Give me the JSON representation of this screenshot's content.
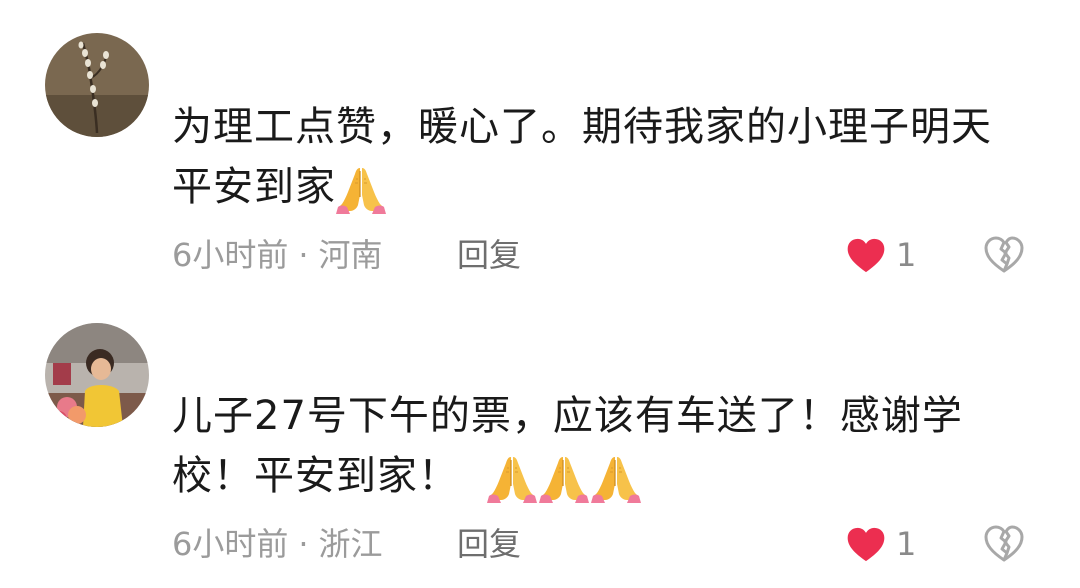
{
  "comments": [
    {
      "text": "为理工点赞，暖心了。期待我家的小理子明天平安到家",
      "time": "6小时前",
      "separator": "·",
      "location": "河南",
      "reply_label": "回复",
      "like_count": "1",
      "emoji_icons": [
        "folded-hands-icon"
      ]
    },
    {
      "text": "儿子27号下午的票，应该有车送了！感谢学校！平安到家！",
      "time": "6小时前",
      "separator": "·",
      "location": "浙江",
      "reply_label": "回复",
      "like_count": "1",
      "emoji_icons": [
        "folded-hands-icon",
        "folded-hands-icon",
        "folded-hands-icon"
      ]
    }
  ],
  "colors": {
    "text": "#1a1a1a",
    "meta": "#9b9b9b",
    "like_heart": "#ec2e50",
    "dislike_icon": "#a8a8a8",
    "background": "#ffffff"
  },
  "icons": {
    "like": "heart-icon",
    "dislike": "broken-heart-icon"
  }
}
